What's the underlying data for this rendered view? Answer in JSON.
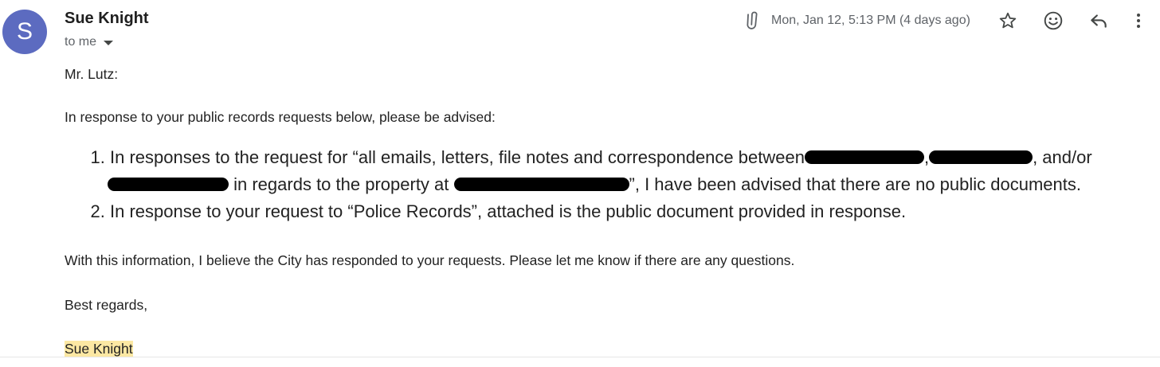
{
  "header": {
    "avatar_letter": "S",
    "sender_name": "Sue Knight",
    "recipient_label": "to me",
    "date_text": "Mon, Jan 12, 5:13 PM (4 days ago)"
  },
  "icons": {
    "attachment": "paperclip-icon",
    "star": "star-icon",
    "react": "smiley-icon",
    "reply": "reply-icon",
    "more": "more-vert-icon"
  },
  "colors": {
    "avatar": "#5c6bc0",
    "signature_highlight": "#fce8a3"
  },
  "body": {
    "salutation": "Mr. Lutz:",
    "intro": "In response to your public records requests below, please be advised:",
    "item1_part1": "In responses to the request for “all emails, letters, file notes and correspondence between",
    "item1_part2": "and/or",
    "item1_part3": "in regards to the property at",
    "item1_part4": "”, I have been advised that there are no public documents.",
    "item2": "In response to your request to “Police Records”, attached is the public document provided in response.",
    "closing_para": "With this information, I believe the City has responded to your requests. Please let me know if there are any questions.",
    "regards": "Best regards,",
    "signature": "Sue Knight"
  }
}
